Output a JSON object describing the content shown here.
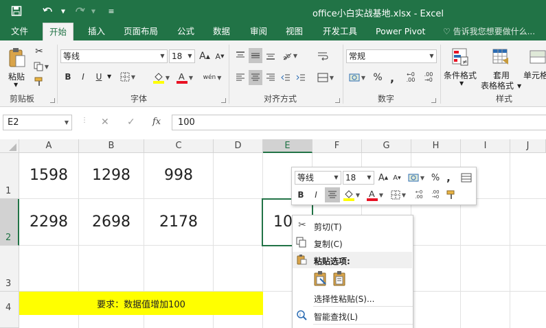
{
  "title_bar": {
    "title": "office小白实战基地.xlsx  -  Excel",
    "save_icon": "save-icon",
    "undo_icon": "undo-icon",
    "redo_icon": "redo-icon",
    "customize_icon": "customize-qat-icon"
  },
  "tabs": [
    "文件",
    "开始",
    "插入",
    "页面布局",
    "公式",
    "数据",
    "审阅",
    "视图",
    "开发工具",
    "Power Pivot"
  ],
  "active_tab": "开始",
  "tell_me": "告诉我您想要做什么...",
  "ribbon": {
    "clipboard": {
      "paste": "粘贴",
      "label": "剪贴板"
    },
    "font": {
      "font_name": "等线",
      "font_size": "18",
      "bold": "B",
      "italic": "I",
      "underline": "U",
      "grow": "A",
      "shrink": "A",
      "phonetic": "wén",
      "label": "字体"
    },
    "alignment": {
      "label": "对齐方式"
    },
    "number": {
      "format": "常规",
      "percent": "%",
      "comma": ",",
      "inc_dec": "←0 .00",
      "dec_dec": ".00 →0",
      "label": "数字"
    },
    "styles": {
      "conditional": "条件格式",
      "table_format_1": "套用",
      "table_format_2": "表格格式",
      "cell_styles": "单元格",
      "label": "样式"
    },
    "colors": {
      "accent": "#217346",
      "font_color": "#e81123",
      "highlight": "#ffff00"
    }
  },
  "formula_bar": {
    "name_box": "E2",
    "cancel": "✕",
    "enter": "✓",
    "fx": "fx",
    "value": "100"
  },
  "columns": [
    "A",
    "B",
    "C",
    "D",
    "E",
    "F",
    "G",
    "H",
    "I",
    "J"
  ],
  "rows": [
    "1",
    "2",
    "3",
    "4"
  ],
  "cells": {
    "A1": "1598",
    "B1": "1298",
    "C1": "998",
    "A2": "2298",
    "B2": "2698",
    "C2": "2178",
    "E2": "10"
  },
  "note": "要求：数据值增加100",
  "mini_toolbar": {
    "font_name": "等线",
    "font_size": "18",
    "percent": "%",
    "comma": ",",
    "bold": "B",
    "italic": "I"
  },
  "context_menu": {
    "cut": "剪切(T)",
    "copy": "复制(C)",
    "paste_options": "粘贴选项:",
    "paste_special": "选择性粘贴(S)...",
    "smart_lookup": "智能查找(L)"
  }
}
